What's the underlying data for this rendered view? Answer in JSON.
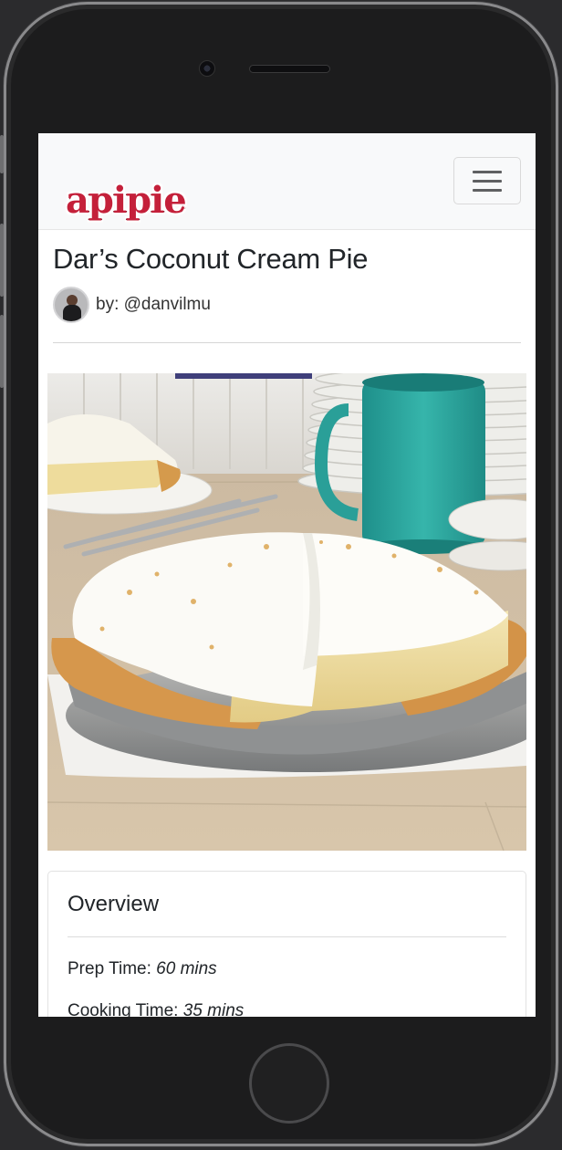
{
  "app": {
    "logo": "apipie"
  },
  "recipe": {
    "title": "Dar’s Coconut Cream Pie",
    "byline": "by: @danvilmu"
  },
  "overview": {
    "heading": "Overview",
    "prep_label": "Prep Time:",
    "prep_value": "60 mins",
    "cook_label": "Cooking Time:",
    "cook_value": "35 mins"
  },
  "colors": {
    "brand": "#c4203a",
    "mug": "#2aa8a0"
  }
}
